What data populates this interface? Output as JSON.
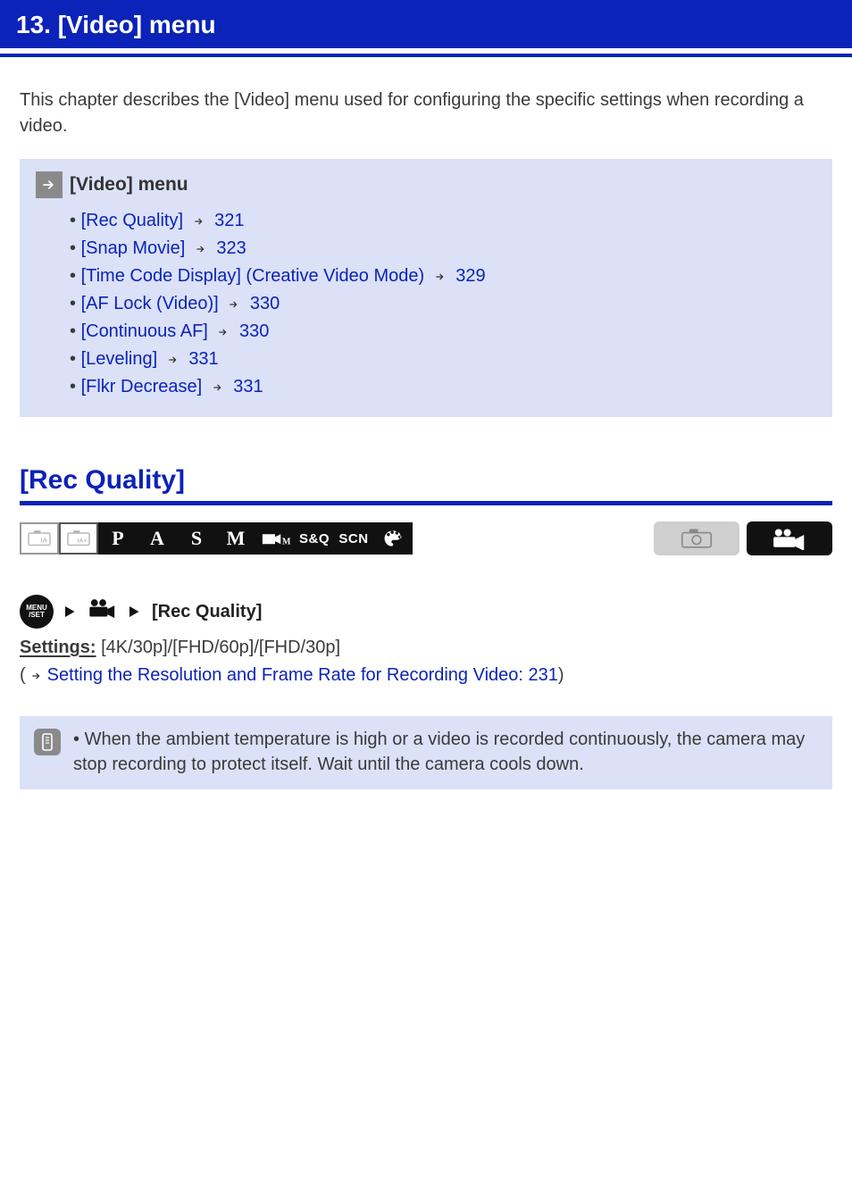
{
  "header": {
    "title_left": "13.",
    "title_right": "[Video] menu"
  },
  "intro": "This chapter describes the [Video] menu used for configuring the specific settings when recording a video.",
  "toc": {
    "title": "[Video] menu",
    "items": [
      {
        "label": "[Rec Quality]",
        "page": "321"
      },
      {
        "label": "[Snap Movie]",
        "page": "323"
      },
      {
        "label": "[Time Code Display] (Creative Video Mode)",
        "page": "329"
      },
      {
        "label": "[AF Lock (Video)]",
        "page": "330"
      },
      {
        "label": "[Continuous AF]",
        "page": "330"
      },
      {
        "label": "[Leveling]",
        "page": "331"
      },
      {
        "label": "[Flkr Decrease]",
        "page": "331"
      }
    ]
  },
  "section": {
    "title": "[Rec Quality]",
    "menu_path_label": "[Rec Quality]",
    "settings_label": "Settings:",
    "settings_value": "[4K/30p]/[FHD/60p]/[FHD/30p]",
    "page_ref_text": "Setting the Resolution and Frame Rate for Recording Video: 231",
    "page_ref_num": "231",
    "note": "When the ambient temperature is high or a video is recorded continuously, the camera may stop recording to protect itself. Wait until the camera cools down."
  },
  "mode_icons": {
    "ia": "iA",
    "ia_plus": "iA+",
    "p": "P",
    "a": "A",
    "s": "S",
    "m": "M",
    "cvm": "crvM",
    "sq": "S&Q",
    "scn": "SCN",
    "palette": "palette-icon"
  },
  "colors": {
    "blue": "#0b23b8",
    "box_bg": "#dbe1f7",
    "icon_gray": "#8a8a8a"
  }
}
